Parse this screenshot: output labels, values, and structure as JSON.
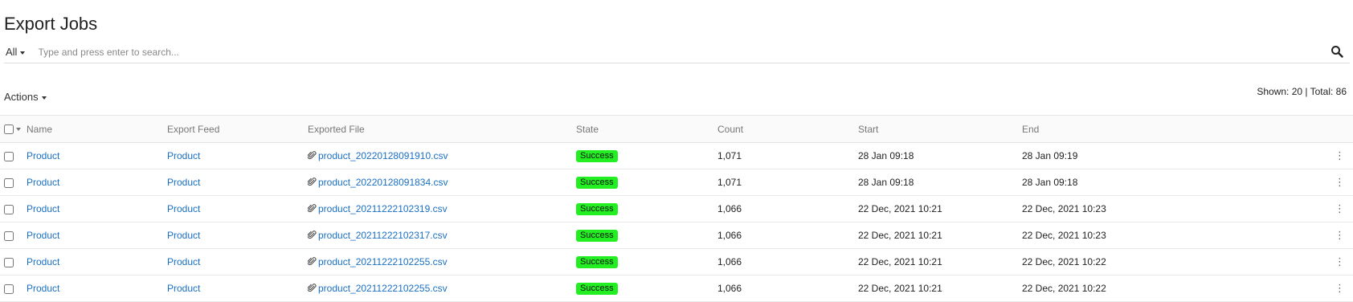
{
  "page": {
    "title": "Export Jobs"
  },
  "search": {
    "scope": "All",
    "placeholder": "Type and press enter to search..."
  },
  "toolbar": {
    "actions_label": "Actions",
    "counts_text": "Shown: 20 | Total: 86"
  },
  "table": {
    "columns": [
      "Name",
      "Export Feed",
      "Exported File",
      "State",
      "Count",
      "Start",
      "End"
    ],
    "rows": [
      {
        "name": "Product",
        "feed": "Product",
        "file": "product_20220128091910.csv",
        "state": "Success",
        "count": "1,071",
        "start": "28 Jan 09:18",
        "end": "28 Jan 09:19"
      },
      {
        "name": "Product",
        "feed": "Product",
        "file": "product_20220128091834.csv",
        "state": "Success",
        "count": "1,071",
        "start": "28 Jan 09:18",
        "end": "28 Jan 09:18"
      },
      {
        "name": "Product",
        "feed": "Product",
        "file": "product_20211222102319.csv",
        "state": "Success",
        "count": "1,066",
        "start": "22 Dec, 2021 10:21",
        "end": "22 Dec, 2021 10:23"
      },
      {
        "name": "Product",
        "feed": "Product",
        "file": "product_20211222102317.csv",
        "state": "Success",
        "count": "1,066",
        "start": "22 Dec, 2021 10:21",
        "end": "22 Dec, 2021 10:23"
      },
      {
        "name": "Product",
        "feed": "Product",
        "file": "product_20211222102255.csv",
        "state": "Success",
        "count": "1,066",
        "start": "22 Dec, 2021 10:21",
        "end": "22 Dec, 2021 10:22"
      },
      {
        "name": "Product",
        "feed": "Product",
        "file": "product_20211222102255.csv",
        "state": "Success",
        "count": "1,066",
        "start": "22 Dec, 2021 10:21",
        "end": "22 Dec, 2021 10:22"
      }
    ]
  },
  "colors": {
    "link": "#1a6fc4",
    "success_badge": "#22ee22"
  },
  "icons": {
    "search": "search-icon",
    "attachment": "paperclip-icon",
    "row_menu": "kebab-icon"
  }
}
